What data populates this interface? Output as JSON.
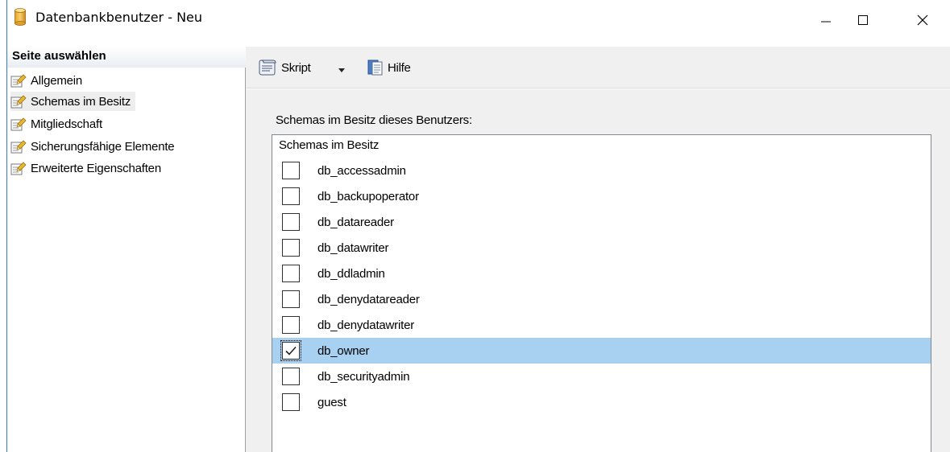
{
  "window": {
    "title": "Datenbankbenutzer - Neu",
    "controls": {
      "minimize": "—",
      "maximize": "☐",
      "close": "✕"
    }
  },
  "left_pane": {
    "title": "Seite auswählen",
    "items": [
      {
        "label": "Allgemein",
        "selected": false
      },
      {
        "label": "Schemas im Besitz",
        "selected": true
      },
      {
        "label": "Mitgliedschaft",
        "selected": false
      },
      {
        "label": "Sicherungsfähige Elemente",
        "selected": false
      },
      {
        "label": "Erweiterte Eigenschaften",
        "selected": false
      }
    ]
  },
  "toolbar": {
    "script_label": "Skript",
    "help_label": "Hilfe"
  },
  "main": {
    "section_label": "Schemas im Besitz dieses Benutzers:",
    "list_header": "Schemas im Besitz",
    "schemas": [
      {
        "name": "db_accessadmin",
        "checked": false
      },
      {
        "name": "db_backupoperator",
        "checked": false
      },
      {
        "name": "db_datareader",
        "checked": false
      },
      {
        "name": "db_datawriter",
        "checked": false
      },
      {
        "name": "db_ddladmin",
        "checked": false
      },
      {
        "name": "db_denydatareader",
        "checked": false
      },
      {
        "name": "db_denydatawriter",
        "checked": false
      },
      {
        "name": "db_owner",
        "checked": true,
        "selected": true
      },
      {
        "name": "db_securityadmin",
        "checked": false
      },
      {
        "name": "guest",
        "checked": false
      }
    ]
  },
  "colors": {
    "selection": "#a8d0f0",
    "panel_bg": "#f0f0f0",
    "accent_border": "#3a78c8"
  }
}
